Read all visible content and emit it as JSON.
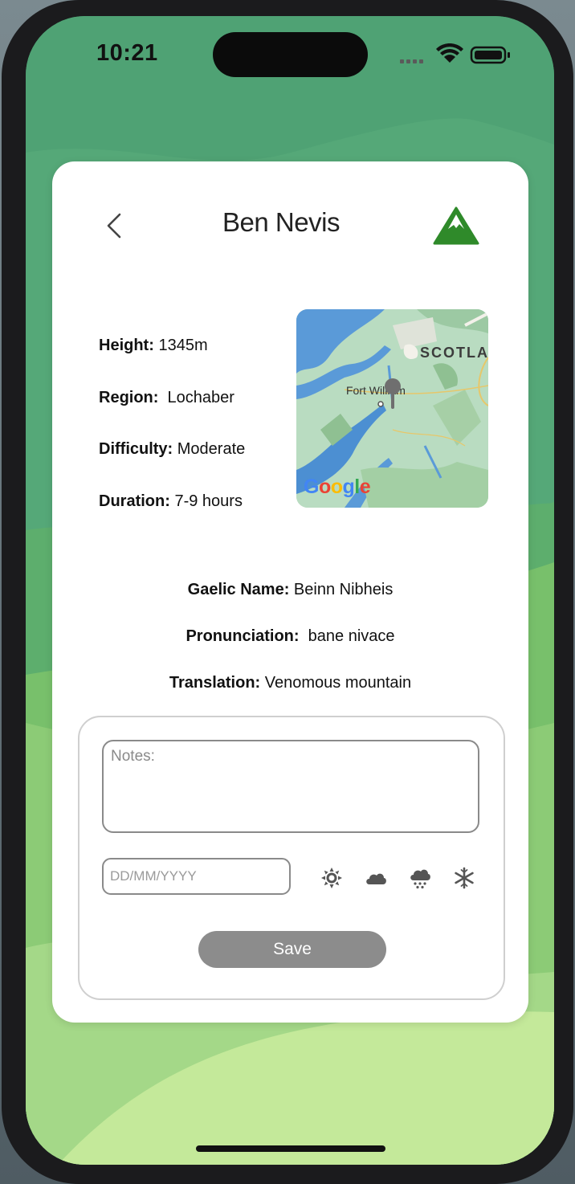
{
  "status_bar": {
    "time": "10:21"
  },
  "header": {
    "title": "Ben Nevis"
  },
  "details": [
    {
      "label": "Height:",
      "value": " 1345m"
    },
    {
      "label": "Region:",
      "value": "  Lochaber"
    },
    {
      "label": "Difficulty:",
      "value": " Moderate"
    },
    {
      "label": "Duration:",
      "value": " 7-9 hours"
    }
  ],
  "map": {
    "place_label": "Fort William",
    "region_label": "SCOTLA",
    "attribution": "Google"
  },
  "gaelic": [
    {
      "label": "Gaelic Name:",
      "value": " Beinn Nibheis"
    },
    {
      "label": "Pronunciation:",
      "value": "  bane nivace"
    },
    {
      "label": "Translation:",
      "value": " Venomous mountain"
    }
  ],
  "form": {
    "notes_placeholder": "Notes:",
    "date_placeholder": "DD/MM/YYYY",
    "weather_icons": [
      "sun-icon",
      "cloud-icon",
      "rain-icon",
      "snow-icon"
    ],
    "save_label": "Save"
  },
  "colors": {
    "accent_green": "#2f8a2a",
    "background_green": "#4fa274",
    "save_button": "#8c8c8c"
  }
}
